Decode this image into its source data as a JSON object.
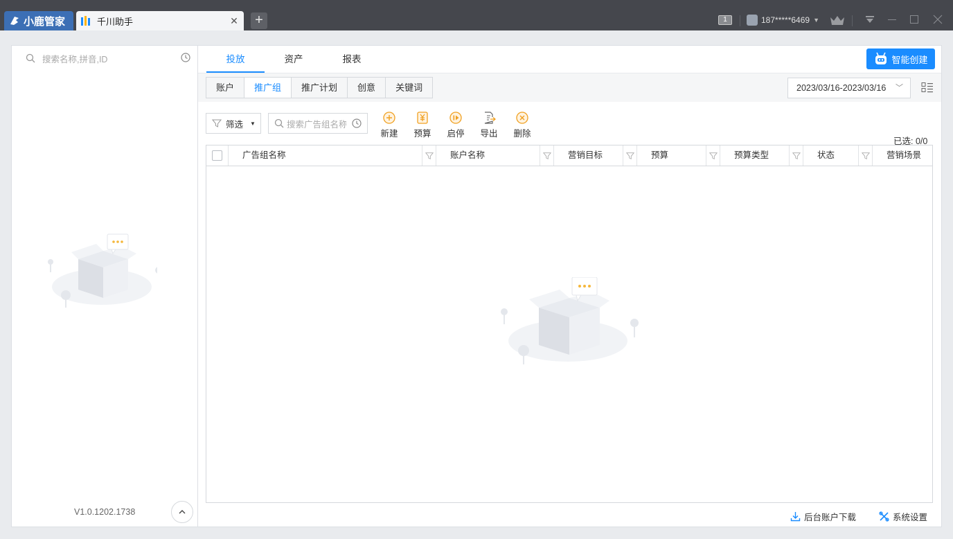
{
  "titlebar": {
    "brand": "小鹿管家",
    "tab_title": "千川助手",
    "close": "✕",
    "new_tab": "+",
    "window_count": "1",
    "user_phone": "187*****6469"
  },
  "left": {
    "search_placeholder": "搜索名称,拼音,ID",
    "version": "V1.0.1202.1738"
  },
  "main": {
    "tabs": [
      {
        "label": "投放",
        "active": true
      },
      {
        "label": "资产",
        "active": false
      },
      {
        "label": "报表",
        "active": false
      }
    ],
    "smart_create": "智能创建",
    "sub_tabs": [
      {
        "label": "账户",
        "active": false
      },
      {
        "label": "推广组",
        "active": true
      },
      {
        "label": "推广计划",
        "active": false
      },
      {
        "label": "创意",
        "active": false
      },
      {
        "label": "关键词",
        "active": false
      }
    ],
    "date_range": "2023/03/16-2023/03/16",
    "filter_label": "筛选",
    "table_search_placeholder": "搜索广告组名称",
    "actions": {
      "new": "新建",
      "budget": "预算",
      "toggle": "启停",
      "export": "导出",
      "delete": "删除"
    },
    "selected_count": "已选: 0/0",
    "columns": [
      "广告组名称",
      "账户名称",
      "营销目标",
      "预算",
      "预算类型",
      "状态",
      "营销场景"
    ],
    "footer": {
      "download": "后台账户下载",
      "settings": "系统设置"
    }
  },
  "colors": {
    "accent": "#1a8cff",
    "titlebar": "#45474d",
    "brand_tab": "#3c6fb5"
  }
}
